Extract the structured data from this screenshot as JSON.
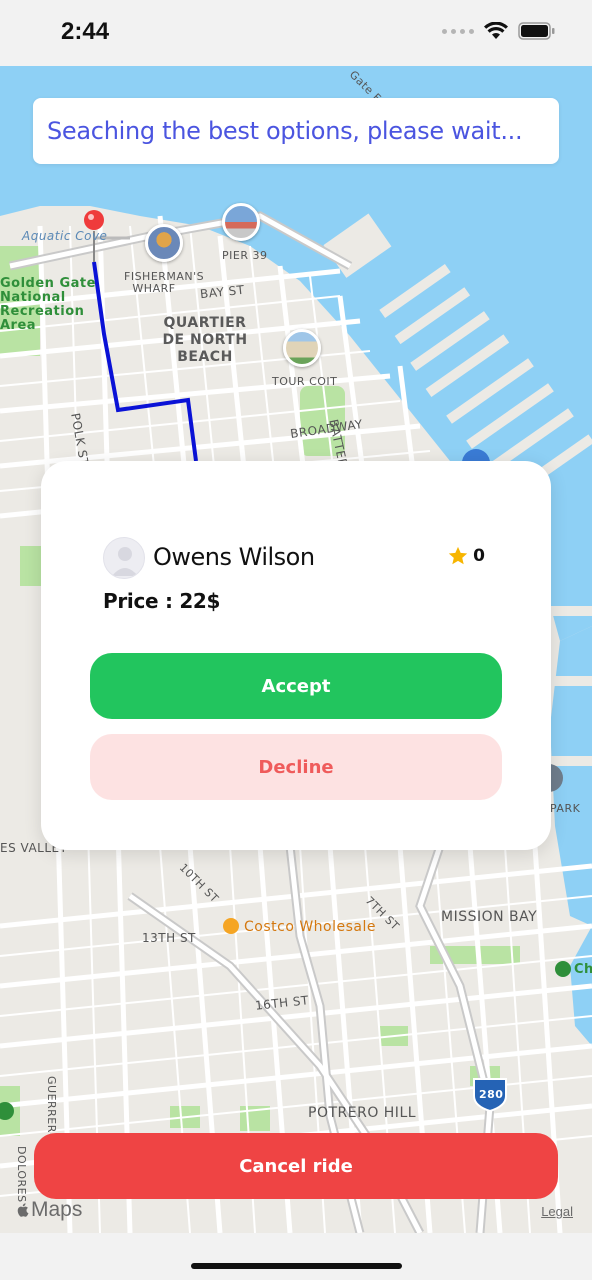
{
  "status_bar": {
    "time": "2:44",
    "icons": [
      "cellular-signal-icon",
      "wifi-icon",
      "battery-icon"
    ]
  },
  "map": {
    "labels": {
      "aquatic_cove": "Aquatic Cove",
      "golden_gate": "Golden Gate National Recreation Area",
      "fishermans_wharf": "FISHERMAN'S WHARF",
      "pier_39": "PIER 39",
      "bay_st": "BAY ST",
      "north_beach": "QUARTIER DE NORTH BEACH",
      "tour_coit": "TOUR COIT",
      "broadway": "BROADWAY",
      "battery_st": "BATTERY ST",
      "polk_st": "POLK ST",
      "gate_f": "Gate F",
      "es_valley": "ES VALLEY",
      "tenth_st": "10TH ST",
      "thirteenth_st": "13TH ST",
      "seventh_st": "7TH ST",
      "costco": "Costco Wholesale",
      "mission_bay": "MISSION BAY",
      "ch": "Ch",
      "sixteenth_st": "16TH ST",
      "potrero_hill": "POTRERO HILL",
      "guerrero": "GUERRERO",
      "dolores": "DOLORES",
      "park": "PARK",
      "highway": "280"
    },
    "route_color": "#0a12d6"
  },
  "search": {
    "text": "Seaching the best options, please wait..."
  },
  "driver_card": {
    "name": "Owens Wilson",
    "rating": "0",
    "price": "Price : 22$",
    "accept_label": "Accept",
    "decline_label": "Decline"
  },
  "cancel_label": "Cancel ride",
  "footer": {
    "maps_label": "Maps",
    "legal_label": "Legal"
  },
  "colors": {
    "accent_green": "#22c55e",
    "decline_bg": "#fde2e2",
    "decline_text": "#ef5b5b",
    "cancel_red": "#ef4444",
    "search_text": "#4b55e0"
  }
}
